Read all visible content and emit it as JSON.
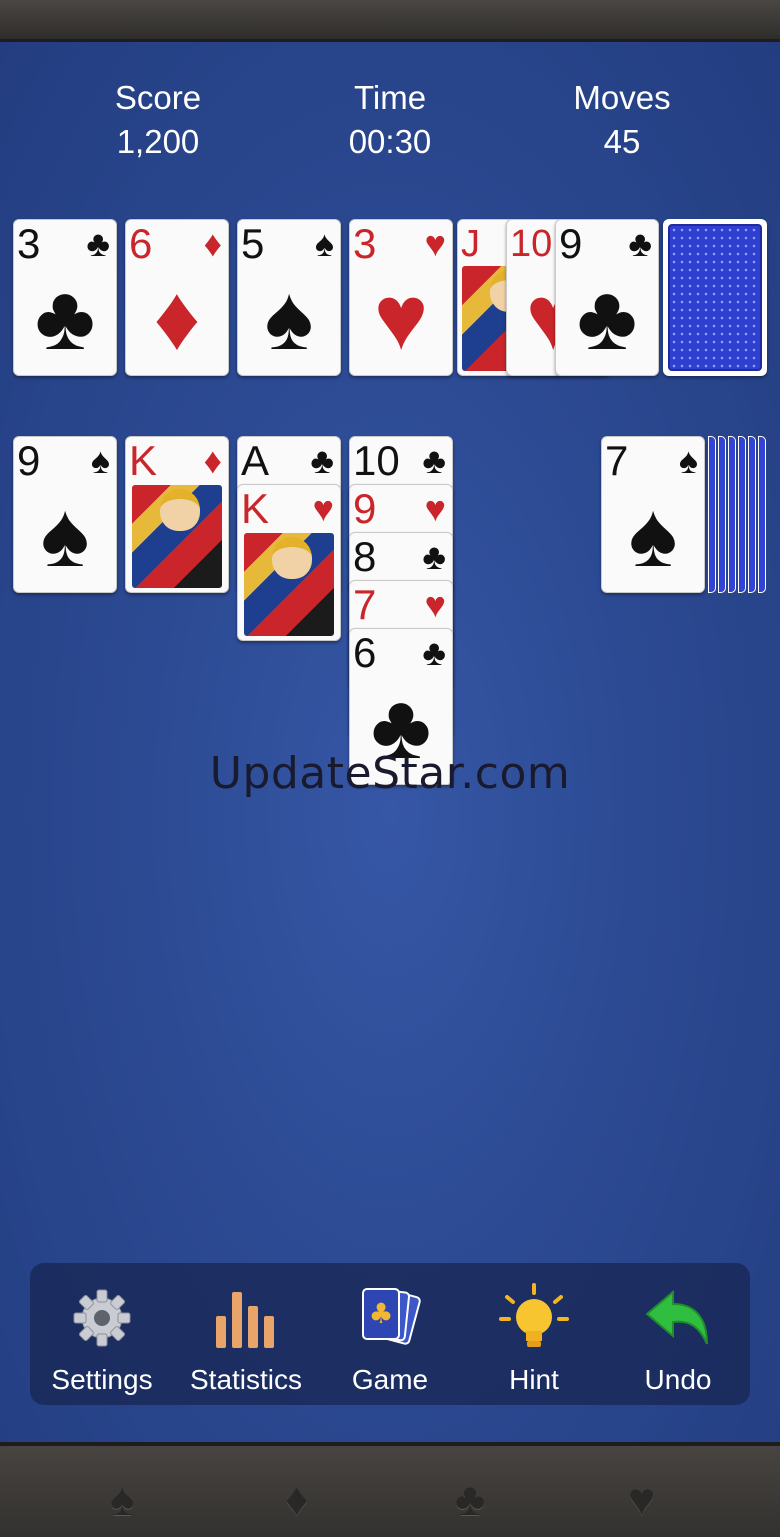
{
  "stats": {
    "score_label": "Score",
    "score_value": "1,200",
    "time_label": "Time",
    "time_value": "00:30",
    "moves_label": "Moves",
    "moves_value": "45"
  },
  "top_row": [
    {
      "rank": "3",
      "suit": "♣",
      "color": "black"
    },
    {
      "rank": "6",
      "suit": "♦",
      "color": "red"
    },
    {
      "rank": "5",
      "suit": "♠",
      "color": "black"
    },
    {
      "rank": "3",
      "suit": "♥",
      "color": "red"
    }
  ],
  "waste": [
    {
      "rank": "J",
      "suit": "",
      "color": "red"
    },
    {
      "rank": "10",
      "suit": "",
      "color": "red"
    },
    {
      "rank": "9",
      "suit": "♣",
      "color": "black"
    }
  ],
  "tableau": {
    "col1": [
      {
        "rank": "9",
        "suit": "♠",
        "color": "black"
      }
    ],
    "col2": [
      {
        "rank": "K",
        "suit": "♦",
        "color": "red"
      }
    ],
    "col3": [
      {
        "rank": "A",
        "suit": "♣",
        "color": "black"
      },
      {
        "rank": "K",
        "suit": "♥",
        "color": "red"
      }
    ],
    "col4": [
      {
        "rank": "10",
        "suit": "♣",
        "color": "black"
      },
      {
        "rank": "9",
        "suit": "♥",
        "color": "red"
      },
      {
        "rank": "8",
        "suit": "♣",
        "color": "black"
      },
      {
        "rank": "7",
        "suit": "♥",
        "color": "red"
      },
      {
        "rank": "6",
        "suit": "♣",
        "color": "black"
      }
    ],
    "right": {
      "rank": "7",
      "suit": "♠",
      "color": "black"
    }
  },
  "watermark": "UpdateStar.com",
  "toolbar": {
    "settings": "Settings",
    "statistics": "Statistics",
    "game": "Game",
    "hint": "Hint",
    "undo": "Undo"
  },
  "decor_suits": [
    "♠",
    "♦",
    "♣",
    "♥"
  ]
}
